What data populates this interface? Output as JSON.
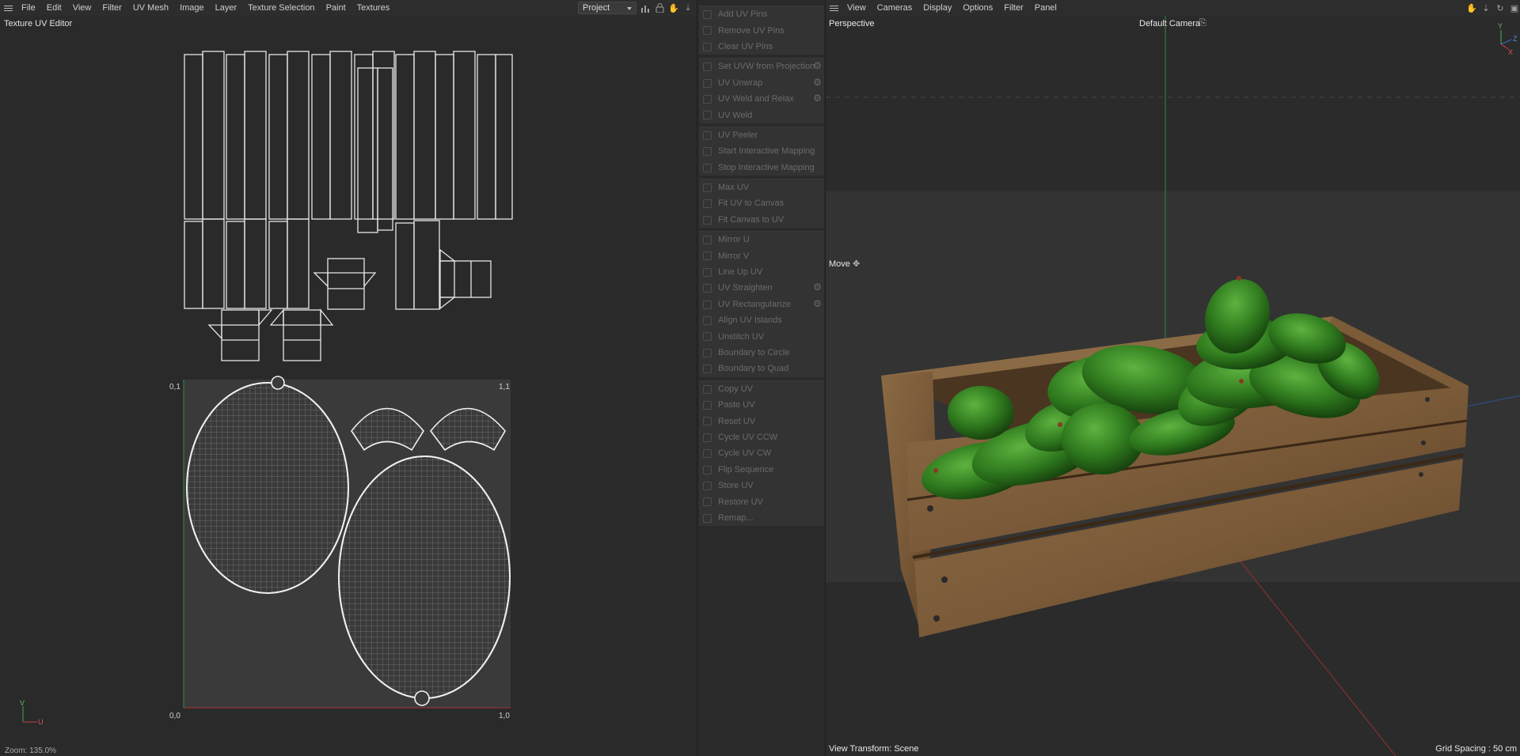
{
  "uv_editor": {
    "menu": [
      "File",
      "Edit",
      "View",
      "Filter",
      "UV Mesh",
      "Image",
      "Layer",
      "Texture Selection",
      "Paint",
      "Textures"
    ],
    "project_select": "Project",
    "title": "Texture UV Editor",
    "corners": {
      "top_left": "0,1",
      "top_right": "1,1",
      "bottom_left": "0,0",
      "bottom_right": "1,0"
    },
    "axis_v": "V",
    "axis_u": "U",
    "zoom": "Zoom: 135.0%",
    "icons": [
      "histogram-icon",
      "lock-icon",
      "hand-pan-icon",
      "pin-icon"
    ]
  },
  "commands": [
    {
      "items": [
        {
          "label": "Add UV Pins",
          "icon": "pin-add-icon",
          "gear": false
        },
        {
          "label": "Remove UV Pins",
          "icon": "pin-remove-icon",
          "gear": false
        },
        {
          "label": "Clear UV Pins",
          "icon": "pin-clear-icon",
          "gear": false
        }
      ]
    },
    {
      "items": [
        {
          "label": "Set UVW from Projection",
          "icon": "projection-icon",
          "gear": true
        },
        {
          "label": "UV Unwrap",
          "icon": "unwrap-icon",
          "gear": true
        },
        {
          "label": "UV Weld and Relax",
          "icon": "weld-relax-icon",
          "gear": true
        },
        {
          "label": "UV Weld",
          "icon": "weld-icon",
          "gear": false
        }
      ]
    },
    {
      "items": [
        {
          "label": "UV Peeler",
          "icon": "peeler-icon",
          "gear": false
        },
        {
          "label": "Start Interactive Mapping",
          "icon": "play-icon",
          "gear": false
        },
        {
          "label": "Stop Interactive Mapping",
          "icon": "stop-icon",
          "gear": false
        }
      ]
    },
    {
      "items": [
        {
          "label": "Max UV",
          "icon": "max-uv-icon",
          "gear": false
        },
        {
          "label": "Fit UV to Canvas",
          "icon": "fit-uv-icon",
          "gear": false
        },
        {
          "label": "Fit Canvas to UV",
          "icon": "fit-canvas-icon",
          "gear": false
        }
      ]
    },
    {
      "items": [
        {
          "label": "Mirror U",
          "icon": "mirror-u-icon",
          "gear": false
        },
        {
          "label": "Mirror V",
          "icon": "mirror-v-icon",
          "gear": false
        },
        {
          "label": "Line Up UV",
          "icon": "line-up-icon",
          "gear": false
        },
        {
          "label": "UV Straighten",
          "icon": "straighten-icon",
          "gear": true
        },
        {
          "label": "UV Rectangularize",
          "icon": "rectangularize-icon",
          "gear": true
        },
        {
          "label": "Align UV Islands",
          "icon": "align-icon",
          "gear": false
        },
        {
          "label": "Unstitch UV",
          "icon": "unstitch-icon",
          "gear": false
        },
        {
          "label": "Boundary to Circle",
          "icon": "circle-icon",
          "gear": false
        },
        {
          "label": "Boundary to Quad",
          "icon": "quad-icon",
          "gear": false
        }
      ]
    },
    {
      "items": [
        {
          "label": "Copy UV",
          "icon": "copy-icon",
          "gear": false
        },
        {
          "label": "Paste UV",
          "icon": "paste-icon",
          "gear": false
        },
        {
          "label": "Reset UV",
          "icon": "reset-icon",
          "gear": false
        },
        {
          "label": "Cycle UV CCW",
          "icon": "cycle-ccw-icon",
          "gear": false
        },
        {
          "label": "Cycle UV CW",
          "icon": "cycle-cw-icon",
          "gear": false
        },
        {
          "label": "Flip Sequence",
          "icon": "flip-icon",
          "gear": false
        },
        {
          "label": "Store UV",
          "icon": "store-icon",
          "gear": false
        },
        {
          "label": "Restore UV",
          "icon": "restore-icon",
          "gear": false
        },
        {
          "label": "Remap...",
          "icon": "remap-icon",
          "gear": false
        }
      ]
    }
  ],
  "viewport": {
    "menu": [
      "View",
      "Cameras",
      "Display",
      "Options",
      "Filter",
      "Panel"
    ],
    "view_name": "Perspective",
    "camera": "Default Camera",
    "tool": "Move",
    "view_transform": "View Transform: Scene",
    "grid_spacing": "Grid Spacing : 50 cm",
    "axis_labels": {
      "y": "Y",
      "z": "Z",
      "x": "X"
    },
    "icons": [
      "hand-pan-icon",
      "move-down-icon",
      "rotate-icon",
      "maximize-icon"
    ]
  }
}
